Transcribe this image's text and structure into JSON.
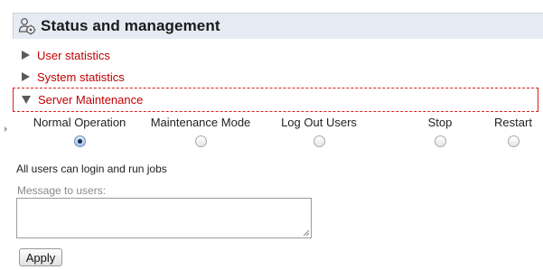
{
  "header": {
    "title": "Status and management",
    "icon": "people-cog-icon"
  },
  "sections": {
    "user_statistics": {
      "label": "User statistics",
      "expanded": false
    },
    "system_statistics": {
      "label": "System statistics",
      "expanded": false
    },
    "server_maintenance": {
      "label": "Server Maintenance",
      "expanded": true
    }
  },
  "maintenance": {
    "options": [
      {
        "label": "Normal Operation",
        "checked": true
      },
      {
        "label": "Maintenance Mode",
        "checked": false
      },
      {
        "label": "Log Out Users",
        "checked": false
      },
      {
        "label": "Stop",
        "checked": false
      },
      {
        "label": "Restart",
        "checked": false
      }
    ],
    "status_text": "All users can login and run jobs",
    "message_label": "Message to users:",
    "message_value": "",
    "apply_label": "Apply"
  },
  "colors": {
    "header_bg": "#e5ebf2",
    "section_link": "#c00000",
    "active_border": "#d92020"
  }
}
